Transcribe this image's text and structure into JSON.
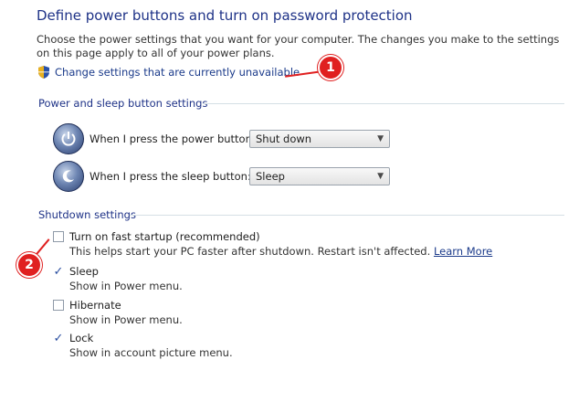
{
  "title": "Define power buttons and turn on password protection",
  "intro": "Choose the power settings that you want for your computer. The changes you make to the settings on this page apply to all of your power plans.",
  "change_link": "Change settings that are currently unavailable",
  "callouts": [
    "1",
    "2"
  ],
  "colors": {
    "callout": "#e02020",
    "title": "#1e3287",
    "link": "#1a3a8a"
  },
  "power_section": {
    "title": "Power and sleep button settings",
    "rows": [
      {
        "label": "When I press the power button:",
        "value": "Shut down",
        "icon": "power-button-icon"
      },
      {
        "label": "When I press the sleep button:",
        "value": "Sleep",
        "icon": "sleep-button-icon"
      }
    ]
  },
  "shutdown_section": {
    "title": "Shutdown settings",
    "items": [
      {
        "label": "Turn on fast startup (recommended)",
        "checked": false,
        "desc_prefix": "This helps start your PC faster after shutdown. Restart isn't affected.",
        "link": "Learn More"
      },
      {
        "label": "Sleep",
        "checked": true,
        "desc": "Show in Power menu."
      },
      {
        "label": "Hibernate",
        "checked": false,
        "desc": "Show in Power menu."
      },
      {
        "label": "Lock",
        "checked": true,
        "desc": "Show in account picture menu."
      }
    ]
  }
}
